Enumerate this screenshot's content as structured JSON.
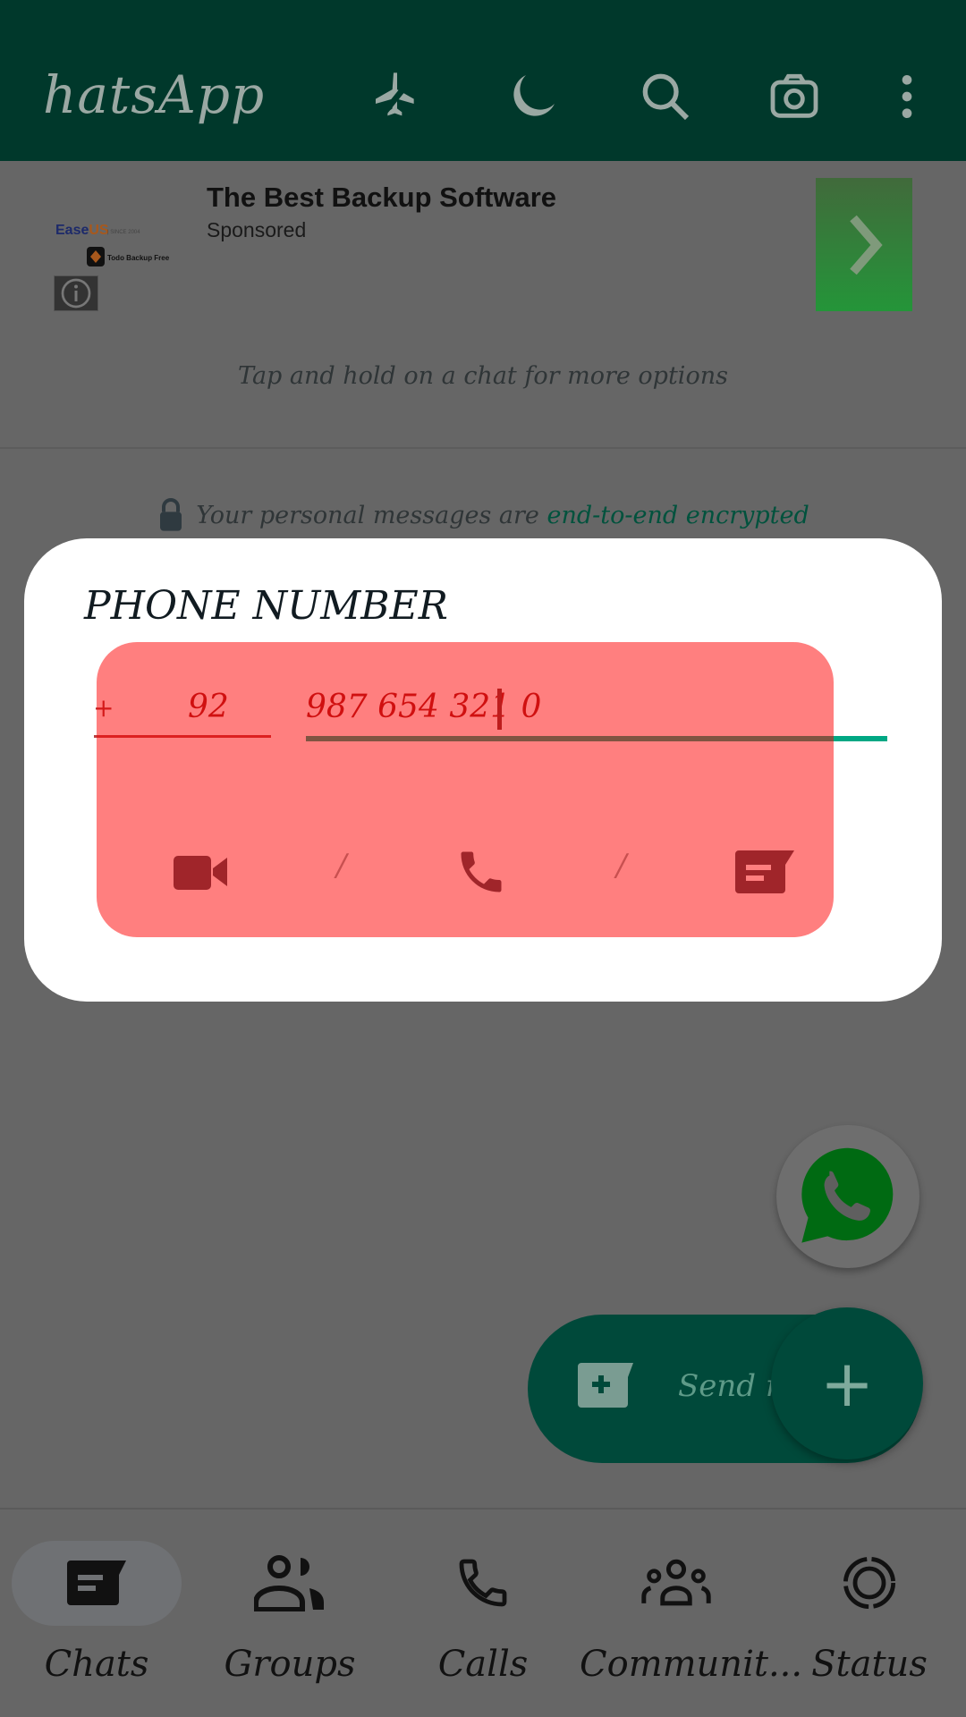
{
  "header": {
    "title": "hatsApp",
    "icons": [
      "airplane-off-icon",
      "moon-icon",
      "search-icon",
      "camera-icon",
      "more-vert-icon"
    ],
    "color": "#00382b"
  },
  "ad": {
    "title": "The Best Backup Software",
    "sponsored": "Sponsored",
    "logo_text": "EaseUS | SINCE 2004 · Todo Backup Free",
    "cta_icon": "chevron-right-icon"
  },
  "hint": "Tap and hold on a chat for more options",
  "encryption": {
    "prefix": "Your personal messages are ",
    "link": "end-to-end encrypted"
  },
  "dialog": {
    "title": "PHONE NUMBER",
    "country_code_prefix": "+",
    "country_code": "92",
    "phone_number": "987 654 321 0",
    "separator": "/",
    "actions": [
      "video-call-icon",
      "voice-call-icon",
      "message-icon"
    ],
    "overlay_color": "#ff7f7f"
  },
  "fab": {
    "send_label": "Send m",
    "plus": "+"
  },
  "nav": [
    {
      "label": "Chats",
      "active": true
    },
    {
      "label": "Groups"
    },
    {
      "label": "Calls"
    },
    {
      "label": "Communit..."
    },
    {
      "label": "Status"
    }
  ]
}
